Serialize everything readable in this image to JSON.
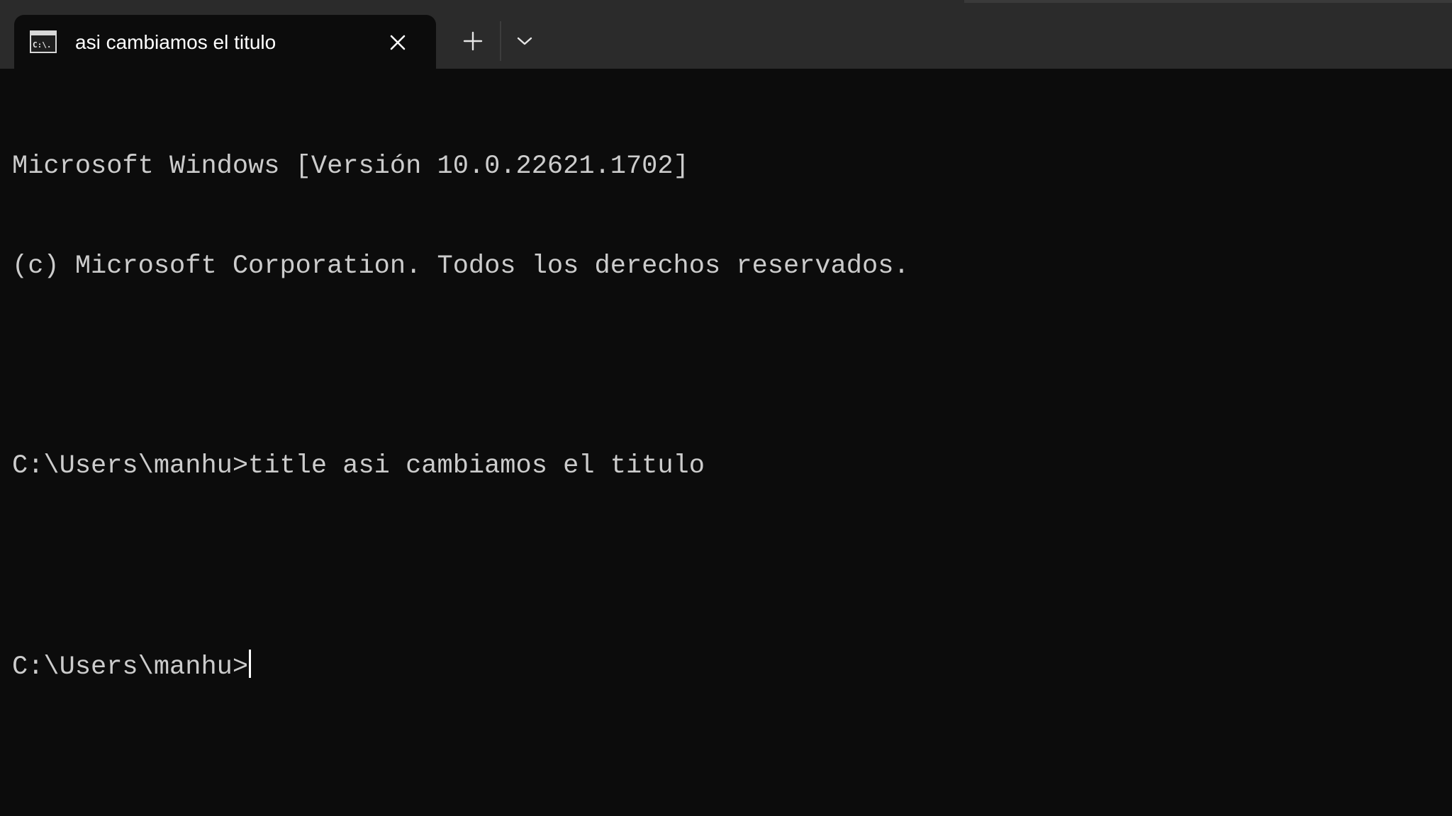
{
  "tab": {
    "title": "asi cambiamos el titulo",
    "icon": "cmd-icon",
    "icon_text": "C:\\."
  },
  "tabbar": {
    "close_icon": "close-icon",
    "new_tab_icon": "plus-icon",
    "dropdown_icon": "chevron-down-icon"
  },
  "terminal": {
    "lines": [
      "Microsoft Windows [Versión 10.0.22621.1702]",
      "(c) Microsoft Corporation. Todos los derechos reservados.",
      "",
      "C:\\Users\\manhu>title asi cambiamos el titulo",
      ""
    ],
    "prompt": "C:\\Users\\manhu>"
  },
  "colors": {
    "background": "#0c0c0c",
    "tabbar": "#2b2b2b",
    "text": "#cccccc"
  }
}
